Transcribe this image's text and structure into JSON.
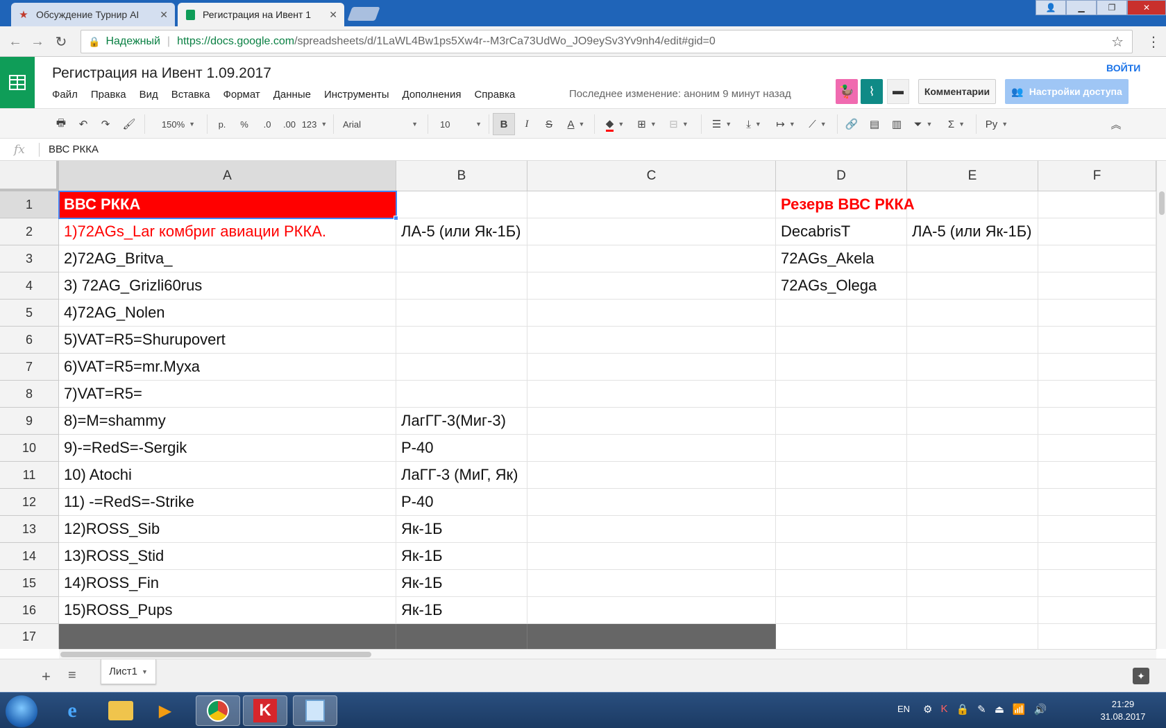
{
  "browser": {
    "tabs": [
      {
        "title": "Обсуждение Турнир AI",
        "icon": "star-icon",
        "active": false
      },
      {
        "title": "Регистрация на Ивент 1",
        "icon": "sheets-icon",
        "active": true
      }
    ],
    "secure_label": "Надежный",
    "url_host": "https://docs.google.com",
    "url_path": "/spreadsheets/d/1LaWL4Bw1ps5Xw4r--M3rCa73UdWo_JO9eySv3Yv9nh4/edit#gid=0"
  },
  "doc": {
    "title": "Регистрация на Ивент 1.09.2017",
    "menu": [
      "Файл",
      "Правка",
      "Вид",
      "Вставка",
      "Формат",
      "Данные",
      "Инструменты",
      "Дополнения",
      "Справка"
    ],
    "last_edit": "Последнее изменение: аноним 9 минут назад",
    "signin": "ВОЙТИ",
    "comments_label": "Комментарии",
    "share_label": "Настройки доступа"
  },
  "toolbar": {
    "zoom": "150%",
    "currency": "р.",
    "percent": "%",
    "dec_less": ".0",
    "dec_more": ".00",
    "format_123": "123",
    "font": "Arial",
    "font_size": "10",
    "bold": "B",
    "italic": "I",
    "strike": "S",
    "textcolor": "A",
    "input_tools": "Ру"
  },
  "formula": {
    "fx": "fx",
    "value": "ВВС РККА"
  },
  "grid": {
    "columns": [
      "A",
      "B",
      "C",
      "D",
      "E",
      "F"
    ],
    "rows": [
      "1",
      "2",
      "3",
      "4",
      "5",
      "6",
      "7",
      "8",
      "9",
      "10",
      "11",
      "12",
      "13",
      "14",
      "15",
      "16",
      "17"
    ],
    "cells": {
      "A1": "ВВС РККА",
      "D1": "Резерв ВВС РККА",
      "A2": "1)72AGs_Lar комбриг авиации РККА.",
      "B2": "ЛА-5 (или Як-1Б)",
      "D2": "DecabrisT",
      "E2": "ЛА-5 (или Як-1Б)",
      "A3": "2)72AG_Britva_",
      "D3": "72AGs_Akela",
      "A4": "3) 72AG_Grizli60rus",
      "D4": "72AGs_Olega",
      "A5": "4)72AG_Nolen",
      "A6": "5)VAT=R5=Shurupovert",
      "A7": "6)VAT=R5=mr.Муха",
      "A8": "7)VAT=R5=",
      "A9": "8)=M=shammy",
      "B9": "ЛагГГ-3(Миг-3)",
      "A10": "9)-=RedS=-Sergik",
      "B10": "P-40",
      "A11": "10) Atochi",
      "B11": "ЛаГГ-3 (МиГ, Як)",
      "A12": "11) -=RedS=-Strike",
      "B12": "P-40",
      "A13": "12)ROSS_Sib",
      "B13": "Як-1Б",
      "A14": "13)ROSS_Stid",
      "B14": "Як-1Б",
      "A15": "14)ROSS_Fin",
      "B15": "Як-1Б",
      "A16": "15)ROSS_Pups",
      "B16": "Як-1Б"
    }
  },
  "sheets": {
    "tabs": [
      "Лист1"
    ]
  },
  "taskbar": {
    "lang": "EN",
    "time": "21:29",
    "date": "31.08.2017"
  },
  "colors": {
    "chrome_blue": "#1f64b8",
    "sheets_green": "#0f9d58",
    "red": "#ff0000",
    "selection": "#4285f4"
  }
}
